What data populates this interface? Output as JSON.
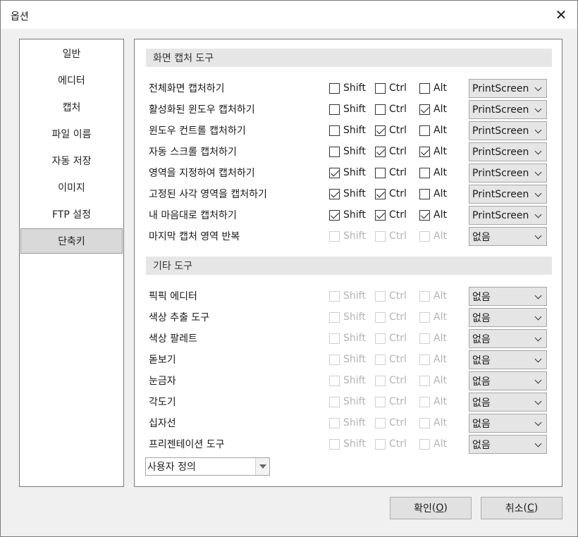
{
  "window": {
    "title": "옵션",
    "close_glyph": "✕"
  },
  "nav": {
    "items": [
      "일반",
      "에디터",
      "캡처",
      "파일 이름",
      "자동 저장",
      "이미지",
      "FTP 설정",
      "단축키"
    ],
    "selected_index": 7
  },
  "labels": {
    "shift": "Shift",
    "ctrl": "Ctrl",
    "alt": "Alt"
  },
  "sections": [
    {
      "title": "화면 캡처 도구",
      "rows": [
        {
          "label": "전체화면 캡처하기",
          "shift": false,
          "ctrl": false,
          "alt": false,
          "enabled": true,
          "key": "PrintScreen"
        },
        {
          "label": "활성화된 윈도우 캡처하기",
          "shift": false,
          "ctrl": false,
          "alt": true,
          "enabled": true,
          "key": "PrintScreen"
        },
        {
          "label": "윈도우 컨트롤 캡처하기",
          "shift": false,
          "ctrl": true,
          "alt": false,
          "enabled": true,
          "key": "PrintScreen"
        },
        {
          "label": "자동 스크롤 캡처하기",
          "shift": false,
          "ctrl": true,
          "alt": true,
          "enabled": true,
          "key": "PrintScreen"
        },
        {
          "label": "영역을 지정하여 캡처하기",
          "shift": true,
          "ctrl": false,
          "alt": false,
          "enabled": true,
          "key": "PrintScreen"
        },
        {
          "label": "고정된 사각 영역을 캡처하기",
          "shift": true,
          "ctrl": true,
          "alt": false,
          "enabled": true,
          "key": "PrintScreen"
        },
        {
          "label": "내 마음대로 캡처하기",
          "shift": true,
          "ctrl": true,
          "alt": true,
          "enabled": true,
          "key": "PrintScreen"
        },
        {
          "label": "마지막 캡처 영역 반복",
          "shift": false,
          "ctrl": false,
          "alt": false,
          "enabled": false,
          "key": "없음"
        }
      ]
    },
    {
      "title": "기타 도구",
      "rows": [
        {
          "label": "픽픽 에디터",
          "shift": false,
          "ctrl": false,
          "alt": false,
          "enabled": false,
          "key": "없음"
        },
        {
          "label": "색상 추출 도구",
          "shift": false,
          "ctrl": false,
          "alt": false,
          "enabled": false,
          "key": "없음"
        },
        {
          "label": "색상 팔레트",
          "shift": false,
          "ctrl": false,
          "alt": false,
          "enabled": false,
          "key": "없음"
        },
        {
          "label": "돋보기",
          "shift": false,
          "ctrl": false,
          "alt": false,
          "enabled": false,
          "key": "없음"
        },
        {
          "label": "눈금자",
          "shift": false,
          "ctrl": false,
          "alt": false,
          "enabled": false,
          "key": "없음"
        },
        {
          "label": "각도기",
          "shift": false,
          "ctrl": false,
          "alt": false,
          "enabled": false,
          "key": "없음"
        },
        {
          "label": "십자선",
          "shift": false,
          "ctrl": false,
          "alt": false,
          "enabled": false,
          "key": "없음"
        },
        {
          "label": "프리젠테이션 도구",
          "shift": false,
          "ctrl": false,
          "alt": false,
          "enabled": false,
          "key": "없음"
        }
      ]
    }
  ],
  "preset": {
    "value": "사용자 정의"
  },
  "buttons": {
    "ok": {
      "label": "확인",
      "mnemonic": "O"
    },
    "cancel": {
      "label": "취소",
      "mnemonic": "C"
    }
  }
}
